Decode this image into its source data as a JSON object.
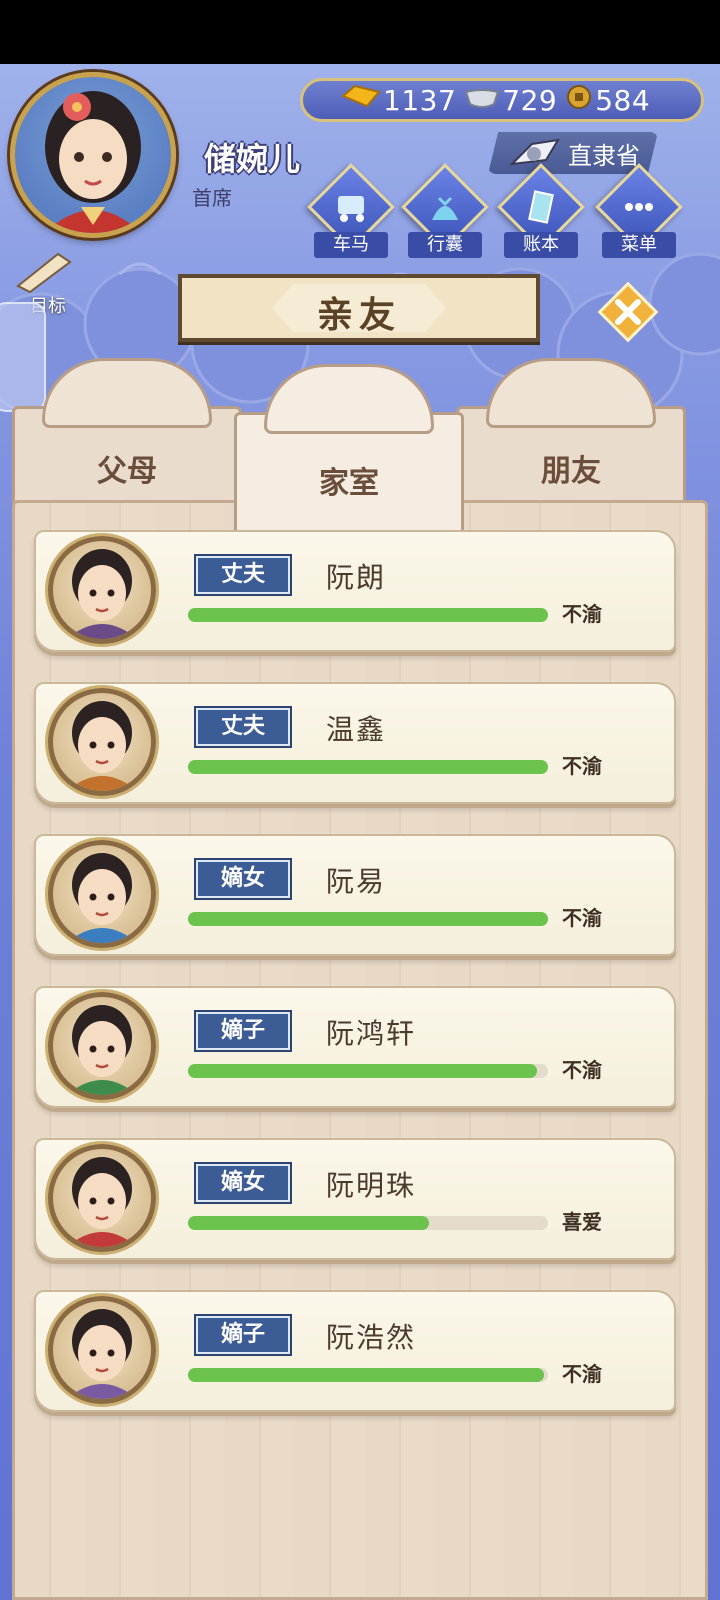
{
  "player": {
    "name": "储婉儿",
    "title": "首席"
  },
  "currency": {
    "gold": "1137",
    "silver": "729",
    "coin": "584"
  },
  "location": "直隶省",
  "menu": {
    "carriage": "车马",
    "luggage": "行囊",
    "ledger": "账本",
    "more": "菜单"
  },
  "goal_label": "目标",
  "page_title": "亲友",
  "tabs": [
    {
      "label": "父母"
    },
    {
      "label": "家室"
    },
    {
      "label": "朋友"
    }
  ],
  "active_tab": "家室",
  "relatives": [
    {
      "relation": "丈夫",
      "name": "阮朗",
      "mood": "不渝",
      "affection": 1.0
    },
    {
      "relation": "丈夫",
      "name": "温鑫",
      "mood": "不渝",
      "affection": 1.0
    },
    {
      "relation": "嫡女",
      "name": "阮易",
      "mood": "不渝",
      "affection": 1.0
    },
    {
      "relation": "嫡子",
      "name": "阮鸿轩",
      "mood": "不渝",
      "affection": 0.97
    },
    {
      "relation": "嫡女",
      "name": "阮明珠",
      "mood": "喜爱",
      "affection": 0.67
    },
    {
      "relation": "嫡子",
      "name": "阮浩然",
      "mood": "不渝",
      "affection": 0.99
    }
  ],
  "colors": {
    "bar_fill": "#6bc24d",
    "tag_bg": "#3b5c94",
    "panel": "#e8d8c6",
    "sky": "#6f82d8"
  }
}
